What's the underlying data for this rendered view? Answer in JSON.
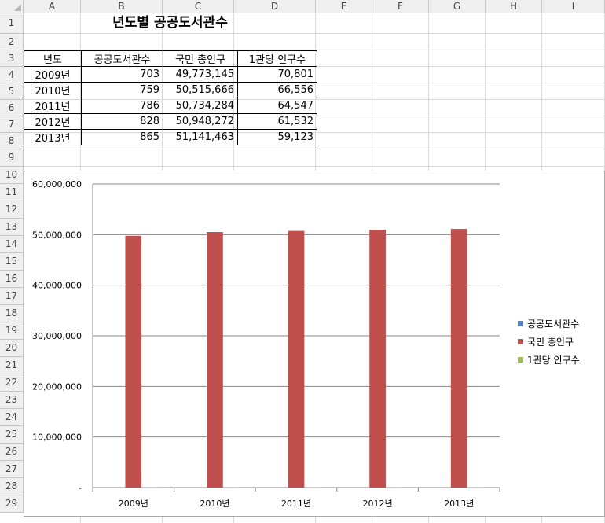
{
  "sheet": {
    "columns": [
      "A",
      "B",
      "C",
      "D",
      "E",
      "F",
      "G",
      "H",
      "I"
    ],
    "rows": [
      "1",
      "2",
      "3",
      "4",
      "5",
      "6",
      "7",
      "8",
      "9",
      "10",
      "11",
      "12",
      "13",
      "14",
      "15",
      "16",
      "17",
      "18",
      "19",
      "20",
      "21",
      "22",
      "23",
      "24",
      "25",
      "26",
      "27",
      "28",
      "29"
    ],
    "title": "년도별 공공도서관수",
    "headers": [
      "년도",
      "공공도서관수",
      "국민 총인구",
      "1관당 인구수"
    ],
    "table": [
      [
        "2009년",
        "703",
        "49,773,145",
        "70,801"
      ],
      [
        "2010년",
        "759",
        "50,515,666",
        "66,556"
      ],
      [
        "2011년",
        "786",
        "50,734,284",
        "64,547"
      ],
      [
        "2012년",
        "828",
        "50,948,272",
        "61,532"
      ],
      [
        "2013년",
        "865",
        "51,141,463",
        "59,123"
      ]
    ]
  },
  "chart_data": {
    "type": "bar",
    "categories": [
      "2009년",
      "2010년",
      "2011년",
      "2012년",
      "2013년"
    ],
    "series": [
      {
        "name": "공공도서관수",
        "values": [
          703,
          759,
          786,
          828,
          865
        ],
        "color": "#4f81bd"
      },
      {
        "name": "국민 총인구",
        "values": [
          49773145,
          50515666,
          50734284,
          50948272,
          51141463
        ],
        "color": "#c0504d"
      },
      {
        "name": "1관당 인구수",
        "values": [
          70801,
          66556,
          64547,
          61532,
          59123
        ],
        "color": "#9bbb59"
      }
    ],
    "ylim": [
      0,
      60000000
    ],
    "yticks": [
      "-",
      "10,000,000",
      "20,000,000",
      "30,000,000",
      "40,000,000",
      "50,000,000",
      "60,000,000"
    ],
    "grid": true,
    "legend": "right"
  }
}
